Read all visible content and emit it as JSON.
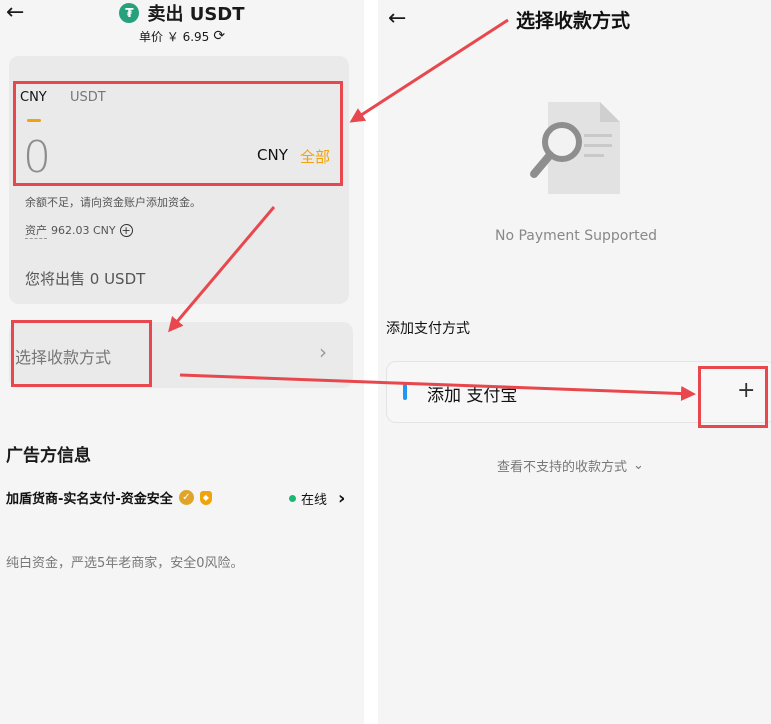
{
  "left": {
    "title": "卖出 USDT",
    "price_label": "单价 ￥ 6.95",
    "tabs": [
      {
        "label": "CNY",
        "active": true
      },
      {
        "label": "USDT",
        "active": false
      }
    ],
    "amount": "0",
    "currency": "CNY",
    "all_label": "全部",
    "insufficient_note": "余额不足，请向资金账户添加资金。",
    "asset_label": "资产",
    "asset_value": "962.03 CNY",
    "sell_summary": "您将出售 0 USDT",
    "select_payment_label": "选择收款方式",
    "advertiser_section_title": "广告方信息",
    "merchant_name": "加盾货商-实名支付-资金安全",
    "online_status": "在线",
    "merchant_description": "纯白资金，严选5年老商家，安全0风险。"
  },
  "right": {
    "title": "选择收款方式",
    "empty_state_text": "No Payment Supported",
    "add_section_title": "添加支付方式",
    "add_option_label": "添加 支付宝",
    "view_unsupported_label": "查看不支持的收款方式"
  },
  "colors": {
    "accent": "#f0a30a",
    "annotation_red": "#e8484d",
    "online_green": "#21b573",
    "alipay_blue": "#2196f3",
    "usdt_green": "#26a17b"
  },
  "icons": [
    "back-arrow-icon",
    "usdt-logo-icon",
    "refresh-icon",
    "plus-circle-icon",
    "chevron-right-icon",
    "verified-badge-icon",
    "shield-icon",
    "document-search-icon",
    "plus-icon",
    "chevron-down-icon"
  ]
}
